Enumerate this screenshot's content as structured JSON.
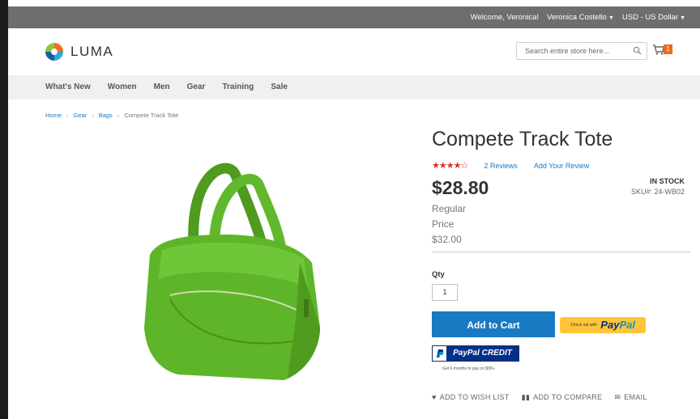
{
  "topbar": {
    "welcome": "Welcome, Veronica!",
    "account": "Veronica Costello",
    "currency": "USD - US Dollar"
  },
  "header": {
    "logo_text": "LUMA",
    "search_placeholder": "Search entire store here...",
    "cart_count": "1",
    "brand_color": "#f26a1e"
  },
  "nav": {
    "items": [
      "What's New",
      "Women",
      "Men",
      "Gear",
      "Training",
      "Sale"
    ]
  },
  "breadcrumb": [
    "Home",
    "Gear",
    "Bags",
    "Compete Track Tote"
  ],
  "product": {
    "title": "Compete Track Tote",
    "rating_percent": 70,
    "reviews": "2  Reviews",
    "add_review": "Add Your Review",
    "price": "$28.80",
    "stock": "IN STOCK",
    "sku": "SKU#:  24-WB02",
    "regular_label_1": "Regular",
    "regular_label_2": "Price",
    "regular_price": "$32.00",
    "qty_label": "Qty",
    "qty_value": "1",
    "add_to_cart": "Add to Cart",
    "paypal_small": "Check out with",
    "paypal_pay": "Pay",
    "paypal_pal": "Pal",
    "paypal_credit": "PayPal CREDIT",
    "paypal_credit_sub": "Get 6 months to pay on $99+",
    "wishlist": "ADD TO WISH LIST",
    "compare": "ADD TO COMPARE",
    "email": "EMAIL",
    "image_color": "#5fb52a"
  }
}
